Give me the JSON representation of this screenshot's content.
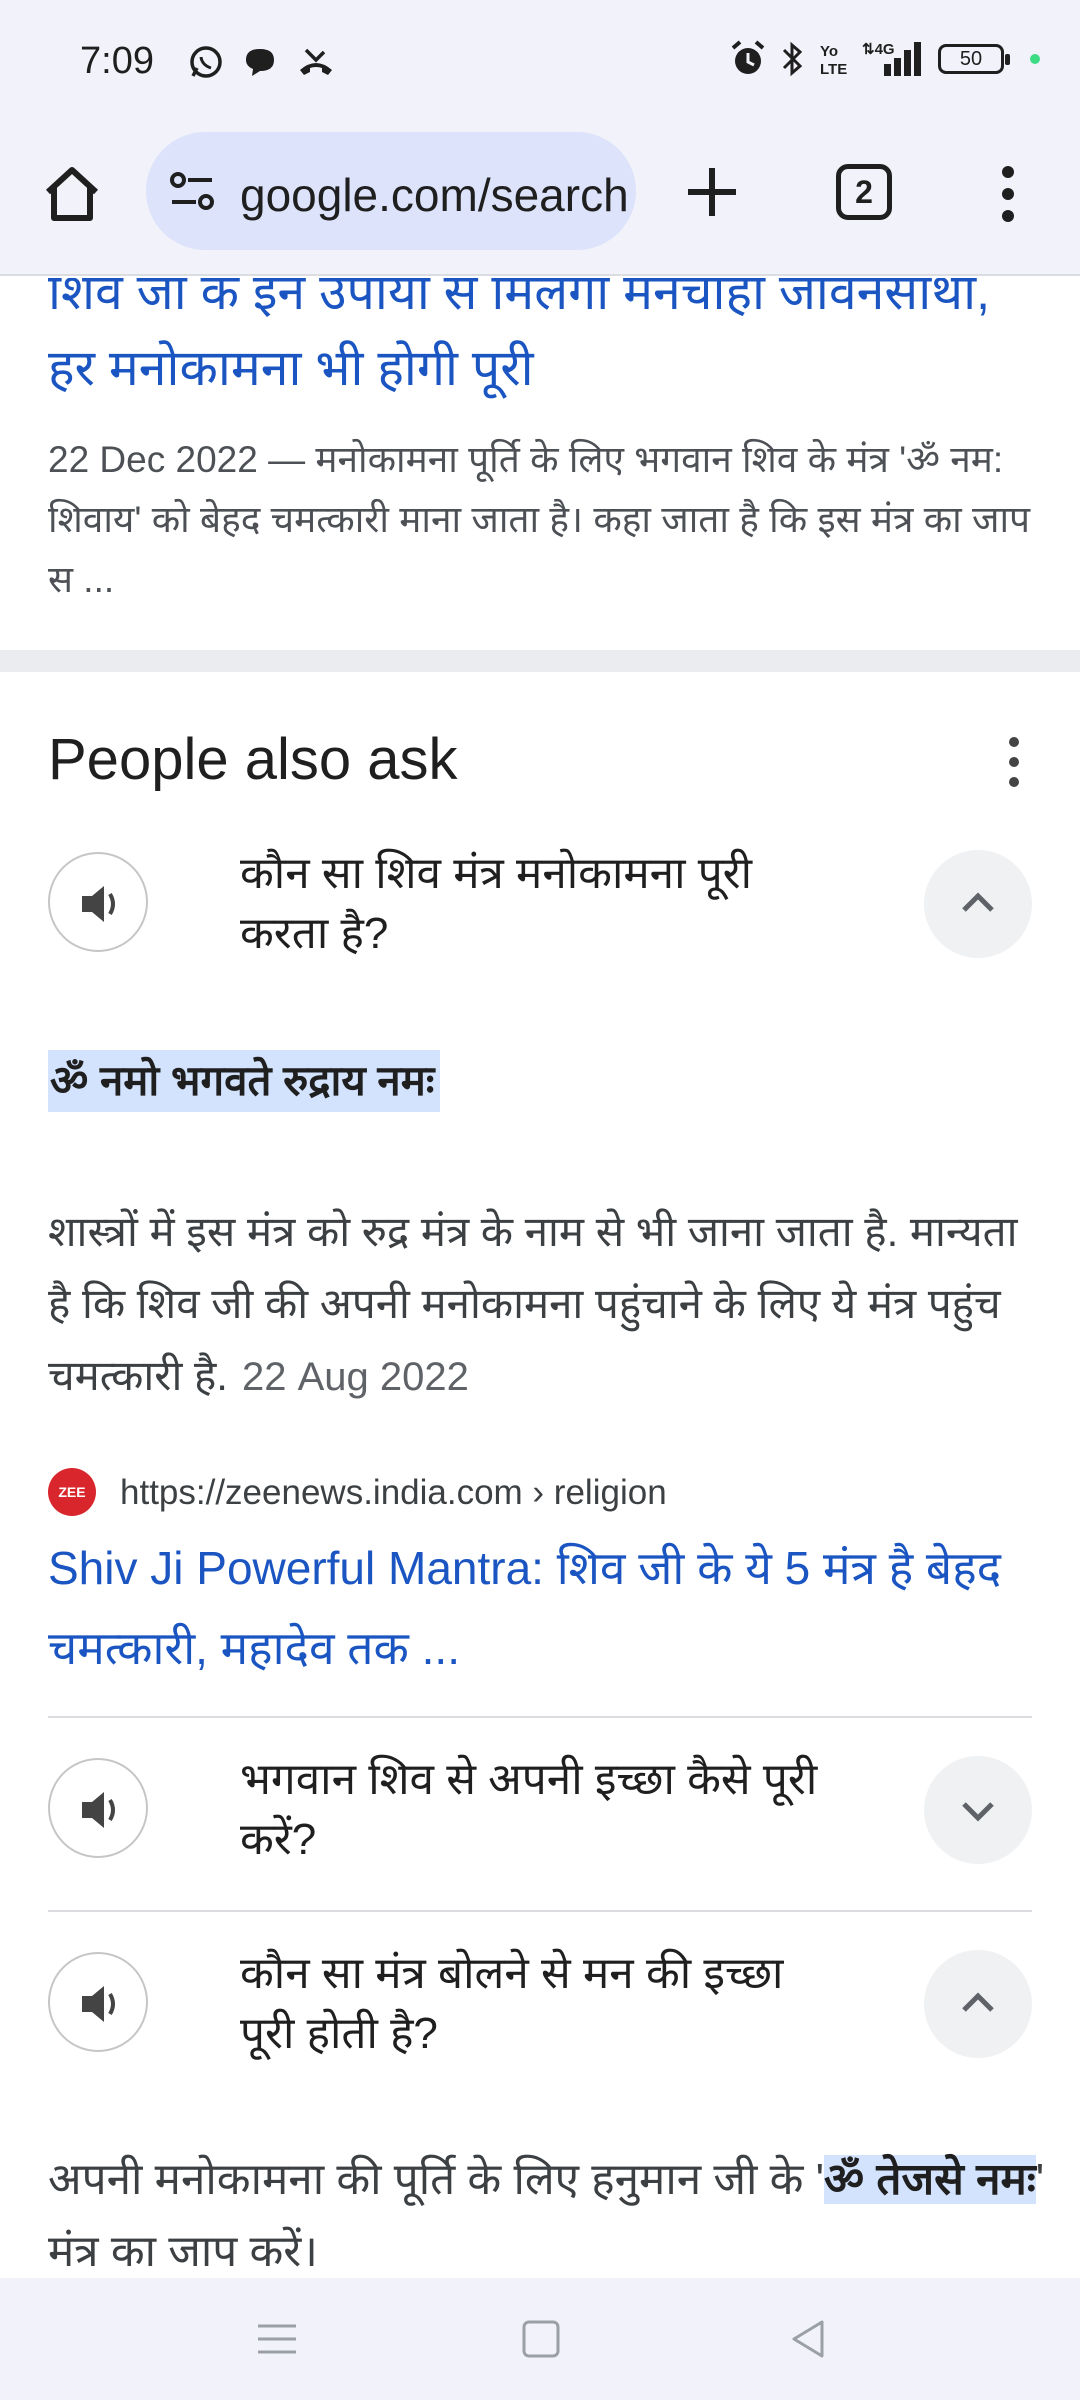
{
  "status_bar": {
    "time": "7:09",
    "left_icons": [
      "whatsapp-icon",
      "chat-bubble-icon",
      "missed-call-icon"
    ],
    "right_icons": [
      "alarm-icon",
      "bluetooth-icon",
      "volte-icon",
      "4g-signal-icon"
    ],
    "battery": "50"
  },
  "toolbar": {
    "url": "google.com/search",
    "tab_count": "2"
  },
  "result": {
    "title": "शिव जी के इन उपायों से मिलेगा मनचाहा जीवनसाथी, हर मनोकामना भी होगी पूरी",
    "date": "22 Dec 2022",
    "snippet": " — मनोकामना पूर्ति के लिए भगवान शिव के मंत्र 'ॐ नम: शिवाय' को बेहद चमत्कारी माना जाता है। कहा जाता है कि इस मंत्र का जाप स ..."
  },
  "people_also_ask": {
    "heading": "People also ask",
    "questions": [
      {
        "text": "कौन सा शिव मंत्र मनोकामना पूरी करता है?",
        "expanded": true
      },
      {
        "text": "भगवान शिव से अपनी इच्छा कैसे पूरी करें?",
        "expanded": false
      },
      {
        "text": "कौन सा मंत्र बोलने से मन की इच्छा पूरी होती है?",
        "expanded": true
      }
    ],
    "answer1": {
      "highlight": "ॐ नमो भगवते रुद्राय नमः",
      "body": "शास्त्रों में इस मंत्र को रुद्र मंत्र के नाम से भी जाना जाता है. मान्यता है कि शिव जी की अपनी मनोकामना पहुंचाने के लिए ये मंत्र पहुंच चमत्कारी है.",
      "date": "22 Aug 2022",
      "source_favicon": "ZEE",
      "source_url": "https://zeenews.india.com › religion",
      "source_title": "Shiv Ji Powerful Mantra: शिव जी के ये 5 मंत्र है बेहद चमत्कारी, महादेव तक ..."
    },
    "answer2": {
      "before": "अपनी मनोकामना की पूर्ति के लिए हनुमान जी के '",
      "highlight": "ॐ तेजसे नमः",
      "after": "' मंत्र का जाप करें।"
    }
  },
  "colors": {
    "link": "#1a55c2",
    "highlight": "#d3e3fd",
    "omnibox": "#dce3fa"
  }
}
